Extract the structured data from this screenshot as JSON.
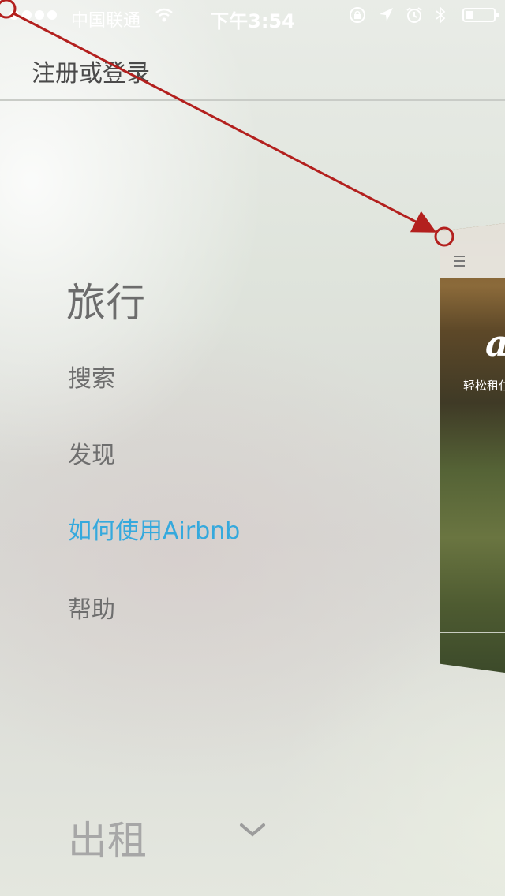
{
  "status_bar": {
    "carrier": "中国联通",
    "time": "下午3:54",
    "signal_icon": "signal-dots-icon",
    "wifi_icon": "wifi-icon",
    "lock_icon": "rotation-lock-icon",
    "location_icon": "location-arrow-icon",
    "alarm_icon": "alarm-icon",
    "bluetooth_icon": "bluetooth-icon",
    "battery_icon": "battery-icon",
    "battery_level": 0.3
  },
  "header": {
    "title": "注册或登录"
  },
  "menu": {
    "travel_heading": "旅行",
    "items": [
      {
        "label": "搜索",
        "active": false
      },
      {
        "label": "发现",
        "active": false
      },
      {
        "label": "如何使用Airbnb",
        "active": true
      },
      {
        "label": "帮助",
        "active": false
      }
    ],
    "host_heading": "出租",
    "expand_icon": "chevron-down-icon"
  },
  "preview": {
    "logo": "a",
    "tagline": "轻松租住",
    "menu_icon": "hamburger-icon"
  },
  "colors": {
    "accent": "#35a9dd",
    "text": "#6e6e6e",
    "annotation": "#b3201e"
  }
}
